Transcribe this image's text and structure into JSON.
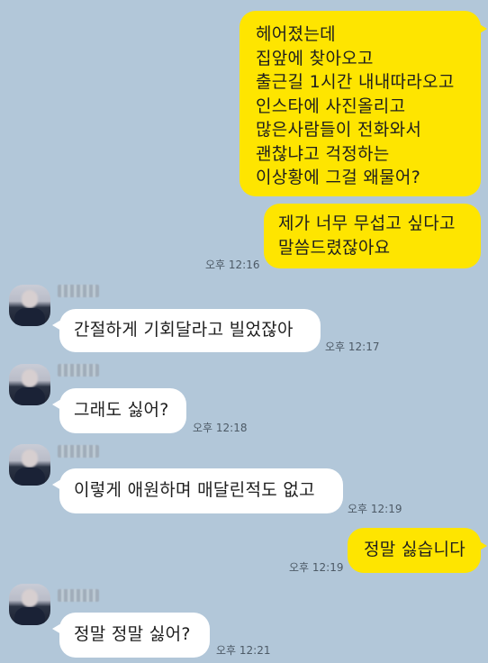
{
  "messages": [
    {
      "sender": "me",
      "text": "헤어졌는데\n집앞에 찾아오고\n출근길 1시간 내내따라오고\n인스타에 사진올리고\n많은사람들이 전화와서\n괜찮냐고 걱정하는\n이상황에 그걸 왜물어?"
    },
    {
      "sender": "me",
      "text": "제가 너무 무섭고 싶다고\n말씀드렸잖아요",
      "time": "오후 12:16"
    },
    {
      "sender": "other",
      "text": "간절하게 기회달라고 빌었잖아",
      "time": "오후 12:17"
    },
    {
      "sender": "other",
      "text": "그래도 싫어?",
      "time": "오후 12:18"
    },
    {
      "sender": "other",
      "text": "이렇게 애원하며 매달린적도 없고",
      "time": "오후 12:19"
    },
    {
      "sender": "me",
      "text": "정말 싫습니다",
      "time": "오후 12:19"
    },
    {
      "sender": "other",
      "text": "정말 정말 싫어?",
      "time": "오후 12:21"
    }
  ],
  "colors": {
    "background": "#b2c7d9",
    "my_bubble": "#fee500",
    "their_bubble": "#ffffff"
  },
  "icons": {
    "avatar": "blurred-profile-photo"
  }
}
